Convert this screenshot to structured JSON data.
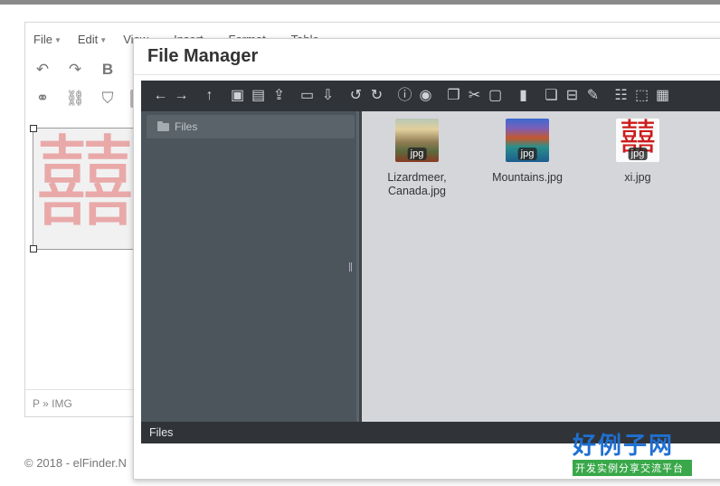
{
  "editor": {
    "menu": [
      "File",
      "Edit",
      "View",
      "Insert",
      "Format",
      "Table"
    ],
    "status_path": "P » IMG",
    "image_glyph": "囍"
  },
  "footer": {
    "text": "© 2018 - elFinder.N"
  },
  "dialog": {
    "title": "File Manager"
  },
  "filemanager": {
    "tree": {
      "root_label": "Files"
    },
    "files": [
      {
        "name": "Lizardmeer, Canada.jpg",
        "badge": "jpg"
      },
      {
        "name": "Mountains.jpg",
        "badge": "jpg"
      },
      {
        "name": "xi.jpg",
        "badge": "jpg",
        "glyph": "囍"
      }
    ],
    "statusbar": "Files"
  },
  "logo": {
    "title": "好例子网",
    "subtitle": "开发实例分享交流平台"
  }
}
